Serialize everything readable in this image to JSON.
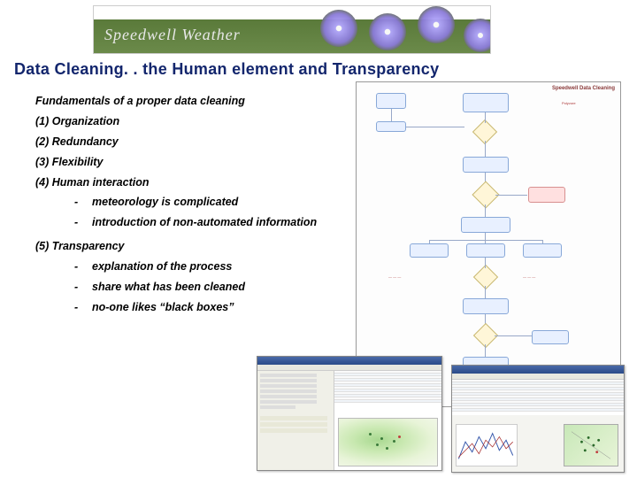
{
  "logo": {
    "brand": "Speedwell Weather"
  },
  "title": "Data Cleaning. . the Human element and Transparency",
  "heading": "Fundamentals of a proper data cleaning",
  "points": {
    "p1": "(1) Organization",
    "p2": "(2) Redundancy",
    "p3": "(3) Flexibility",
    "p4": "(4) Human interaction",
    "p4_b1": "meteorology is complicated",
    "p4_b2": "introduction of non-automated information",
    "p5": "(5) Transparency",
    "p5_b1": "explanation of the process",
    "p5_b2": "share what has been cleaned",
    "p5_b3": "no-one likes “black boxes”"
  },
  "flowchart": {
    "diagram_title": "Speedwell Data Cleaning",
    "note_label": "Polyvore"
  },
  "screenshots": {
    "app1_hint": "data cleaning map tool",
    "app2_hint": "time series audit tool"
  }
}
